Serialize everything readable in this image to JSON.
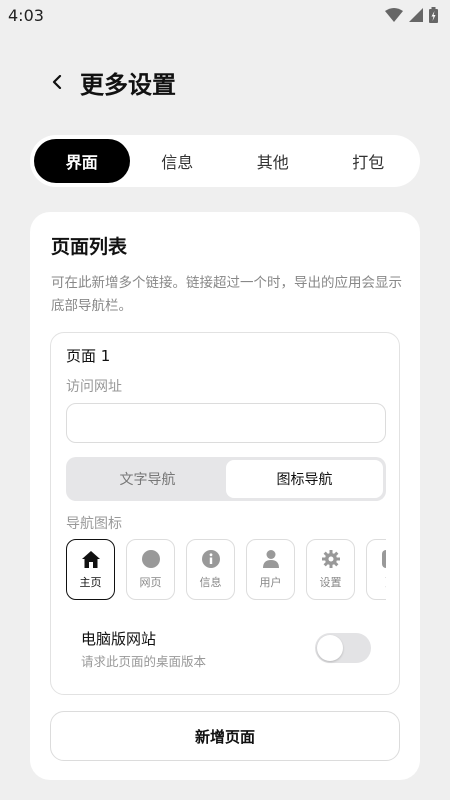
{
  "status_bar": {
    "time": "4:03"
  },
  "header": {
    "title": "更多设置"
  },
  "tabs": [
    {
      "label": "界面",
      "active": true
    },
    {
      "label": "信息",
      "active": false
    },
    {
      "label": "其他",
      "active": false
    },
    {
      "label": "打包",
      "active": false
    }
  ],
  "card": {
    "title": "页面列表",
    "description": "可在此新增多个链接。链接超过一个时，导出的应用会显示底部导航栏。",
    "page": {
      "name": "页面 1",
      "url_label": "访问网址",
      "url_value": "",
      "url_placeholder": "",
      "nav_mode": {
        "text": "文字导航",
        "icon": "图标导航",
        "selected": "icon"
      },
      "icons_label": "导航图标",
      "icons": [
        {
          "name": "home-icon",
          "label": "主页",
          "active": true
        },
        {
          "name": "circle-icon",
          "label": "网页",
          "active": false
        },
        {
          "name": "info-icon",
          "label": "信息",
          "active": false
        },
        {
          "name": "user-icon",
          "label": "用户",
          "active": false
        },
        {
          "name": "gear-icon",
          "label": "设置",
          "active": false
        },
        {
          "name": "more-icon",
          "label": "更",
          "active": false
        }
      ],
      "desktop": {
        "title": "电脑版网站",
        "description": "请求此页面的桌面版本",
        "enabled": false
      }
    },
    "add_button": "新增页面"
  },
  "colors": {
    "accent": "#000000",
    "background": "#efefef",
    "card": "#ffffff"
  }
}
